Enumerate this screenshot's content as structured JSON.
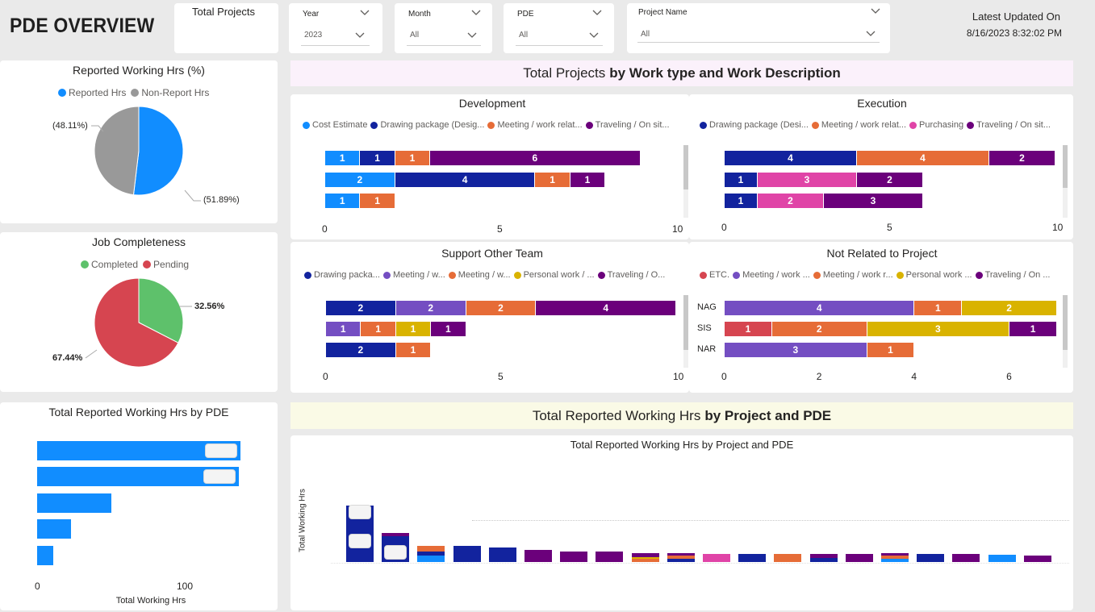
{
  "page": {
    "title": "PDE OVERVIEW"
  },
  "kpi": {
    "total_projects_label": "Total Projects"
  },
  "slicers": {
    "year": {
      "label": "Year",
      "value": "2023"
    },
    "month": {
      "label": "Month",
      "value": "All"
    },
    "pde": {
      "label": "PDE",
      "value": "All"
    },
    "project_name": {
      "label": "Project Name",
      "value": "All"
    }
  },
  "updated": {
    "label": "Latest Updated On",
    "value": "8/16/2023 8:32:02 PM"
  },
  "colors": {
    "blue": "#118dff",
    "navy": "#12239e",
    "orange": "#e66c37",
    "purple": "#6b007b",
    "pink": "#e044a7",
    "violet": "#744ec2",
    "gold": "#d9b300",
    "red": "#d64550",
    "green": "#5ec16b",
    "gray": "#999999"
  },
  "banners": {
    "projects": {
      "normal": "Total Projects",
      "bold": "by Work type and Work Description"
    },
    "hours": {
      "normal": "Total Reported Working Hrs",
      "bold": "by Project and PDE"
    }
  },
  "chart_data": [
    {
      "id": "reported-working-hrs",
      "type": "pie",
      "title": "Reported Working Hrs (%)",
      "legend": [
        "Reported Hrs",
        "Non-Report Hrs"
      ],
      "slices": [
        {
          "name": "Reported Hrs",
          "value": 51.89,
          "label": "(51.89%)",
          "color": "#118dff"
        },
        {
          "name": "Non-Report Hrs",
          "value": 48.11,
          "label": "(48.11%)",
          "color": "#999999"
        }
      ]
    },
    {
      "id": "job-completeness",
      "type": "pie",
      "title": "Job Completeness",
      "legend": [
        "Completed",
        "Pending"
      ],
      "slices": [
        {
          "name": "Completed",
          "value": 32.56,
          "label": "32.56%",
          "color": "#5ec16b"
        },
        {
          "name": "Pending",
          "value": 67.44,
          "label": "67.44%",
          "color": "#d64550"
        }
      ]
    },
    {
      "id": "development",
      "type": "bar",
      "title": "Development",
      "legend": [
        {
          "name": "Cost Estimate",
          "color": "#118dff"
        },
        {
          "name": "Drawing package (Desig...",
          "color": "#12239e"
        },
        {
          "name": "Meeting / work relat...",
          "color": "#e66c37"
        },
        {
          "name": "Traveling / On sit...",
          "color": "#6b007b"
        }
      ],
      "xlim": [
        0,
        10
      ],
      "xticks": [
        "0",
        "5",
        "10"
      ],
      "categories": [
        "",
        "",
        ""
      ],
      "rows": [
        [
          {
            "v": 1,
            "c": "#118dff"
          },
          {
            "v": 1,
            "c": "#12239e"
          },
          {
            "v": 1,
            "c": "#e66c37"
          },
          {
            "v": 6,
            "c": "#6b007b"
          }
        ],
        [
          {
            "v": 2,
            "c": "#118dff"
          },
          {
            "v": 4,
            "c": "#12239e"
          },
          {
            "v": 1,
            "c": "#e66c37"
          },
          {
            "v": 1,
            "c": "#6b007b"
          }
        ],
        [
          {
            "v": 1,
            "c": "#118dff"
          },
          {
            "v": 1,
            "c": "#e66c37"
          }
        ]
      ]
    },
    {
      "id": "execution",
      "type": "bar",
      "title": "Execution",
      "legend": [
        {
          "name": "Drawing package (Desi...",
          "color": "#12239e"
        },
        {
          "name": "Meeting / work relat...",
          "color": "#e66c37"
        },
        {
          "name": "Purchasing",
          "color": "#e044a7"
        },
        {
          "name": "Traveling / On sit...",
          "color": "#6b007b"
        }
      ],
      "xlim": [
        0,
        10
      ],
      "xticks": [
        "0",
        "5",
        "10"
      ],
      "categories": [
        "",
        "",
        ""
      ],
      "rows": [
        [
          {
            "v": 4,
            "c": "#12239e"
          },
          {
            "v": 4,
            "c": "#e66c37"
          },
          {
            "v": 2,
            "c": "#6b007b"
          }
        ],
        [
          {
            "v": 1,
            "c": "#12239e"
          },
          {
            "v": 3,
            "c": "#e044a7"
          },
          {
            "v": 2,
            "c": "#6b007b"
          }
        ],
        [
          {
            "v": 1,
            "c": "#12239e"
          },
          {
            "v": 2,
            "c": "#e044a7"
          },
          {
            "v": 3,
            "c": "#6b007b"
          }
        ]
      ]
    },
    {
      "id": "support-other-team",
      "type": "bar",
      "title": "Support Other Team",
      "legend": [
        {
          "name": "Drawing packa...",
          "color": "#12239e"
        },
        {
          "name": "Meeting / w...",
          "color": "#744ec2"
        },
        {
          "name": "Meeting / w...",
          "color": "#e66c37"
        },
        {
          "name": "Personal work / ...",
          "color": "#d9b300"
        },
        {
          "name": "Traveling / O...",
          "color": "#6b007b"
        }
      ],
      "xlim": [
        0,
        10
      ],
      "xticks": [
        "0",
        "5",
        "10"
      ],
      "categories": [
        "",
        "",
        ""
      ],
      "rows": [
        [
          {
            "v": 2,
            "c": "#12239e"
          },
          {
            "v": 2,
            "c": "#744ec2"
          },
          {
            "v": 2,
            "c": "#e66c37"
          },
          {
            "v": 4,
            "c": "#6b007b"
          }
        ],
        [
          {
            "v": 1,
            "c": "#744ec2"
          },
          {
            "v": 1,
            "c": "#e66c37"
          },
          {
            "v": 1,
            "c": "#d9b300"
          },
          {
            "v": 1,
            "c": "#6b007b"
          }
        ],
        [
          {
            "v": 2,
            "c": "#12239e"
          },
          {
            "v": 1,
            "c": "#e66c37"
          }
        ]
      ]
    },
    {
      "id": "not-related-to-project",
      "type": "bar",
      "title": "Not Related to Project",
      "legend": [
        {
          "name": "ETC.",
          "color": "#d64550"
        },
        {
          "name": "Meeting / work ...",
          "color": "#744ec2"
        },
        {
          "name": "Meeting / work r...",
          "color": "#e66c37"
        },
        {
          "name": "Personal work ...",
          "color": "#d9b300"
        },
        {
          "name": "Traveling / On ...",
          "color": "#6b007b"
        }
      ],
      "xlim": [
        0,
        7
      ],
      "xticks": [
        "0",
        "2",
        "4",
        "6"
      ],
      "categories": [
        "NAG",
        "SIS",
        "NAR"
      ],
      "rows": [
        [
          {
            "v": 4,
            "c": "#744ec2"
          },
          {
            "v": 1,
            "c": "#e66c37"
          },
          {
            "v": 2,
            "c": "#d9b300"
          }
        ],
        [
          {
            "v": 1,
            "c": "#d64550"
          },
          {
            "v": 2,
            "c": "#e66c37"
          },
          {
            "v": 3,
            "c": "#d9b300"
          },
          {
            "v": 1,
            "c": "#6b007b"
          }
        ],
        [
          {
            "v": 3,
            "c": "#744ec2"
          },
          {
            "v": 1,
            "c": "#e66c37"
          }
        ]
      ]
    },
    {
      "id": "hrs-by-pde",
      "type": "bar",
      "title": "Total Reported Working Hrs by PDE",
      "xlabel": "Total Working Hrs",
      "xticks": [
        "0",
        "100"
      ],
      "xlim": [
        0,
        140
      ],
      "values": [
        137,
        136,
        50,
        23,
        11
      ]
    },
    {
      "id": "hrs-by-project-pde",
      "type": "bar",
      "title": "Total Reported Working Hrs by Project and PDE",
      "ylabel": "Total Working Hrs",
      "ylim": [
        0,
        60
      ],
      "stacks": [
        [
          {
            "v": 55,
            "c": "#12239e"
          }
        ],
        [
          {
            "v": 25,
            "c": "#12239e"
          },
          {
            "v": 3,
            "c": "#6b007b"
          }
        ],
        [
          {
            "v": 6,
            "c": "#118dff"
          },
          {
            "v": 4,
            "c": "#12239e"
          },
          {
            "v": 6,
            "c": "#e66c37"
          }
        ],
        [
          {
            "v": 16,
            "c": "#12239e"
          }
        ],
        [
          {
            "v": 14,
            "c": "#12239e"
          }
        ],
        [
          {
            "v": 12,
            "c": "#6b007b"
          }
        ],
        [
          {
            "v": 10,
            "c": "#6b007b"
          }
        ],
        [
          {
            "v": 10,
            "c": "#6b007b"
          }
        ],
        [
          {
            "v": 3,
            "c": "#e66c37"
          },
          {
            "v": 2,
            "c": "#d9b300"
          },
          {
            "v": 4,
            "c": "#6b007b"
          }
        ],
        [
          {
            "v": 3,
            "c": "#12239e"
          },
          {
            "v": 3,
            "c": "#e66c37"
          },
          {
            "v": 3,
            "c": "#6b007b"
          }
        ],
        [
          {
            "v": 8,
            "c": "#e044a7"
          }
        ],
        [
          {
            "v": 8,
            "c": "#12239e"
          }
        ],
        [
          {
            "v": 8,
            "c": "#e66c37"
          }
        ],
        [
          {
            "v": 4,
            "c": "#12239e"
          },
          {
            "v": 4,
            "c": "#6b007b"
          }
        ],
        [
          {
            "v": 8,
            "c": "#6b007b"
          }
        ],
        [
          {
            "v": 3,
            "c": "#118dff"
          },
          {
            "v": 3,
            "c": "#e66c37"
          },
          {
            "v": 3,
            "c": "#6b007b"
          }
        ],
        [
          {
            "v": 8,
            "c": "#12239e"
          }
        ],
        [
          {
            "v": 8,
            "c": "#6b007b"
          }
        ],
        [
          {
            "v": 7,
            "c": "#118dff"
          }
        ],
        [
          {
            "v": 6,
            "c": "#6b007b"
          }
        ]
      ]
    }
  ]
}
